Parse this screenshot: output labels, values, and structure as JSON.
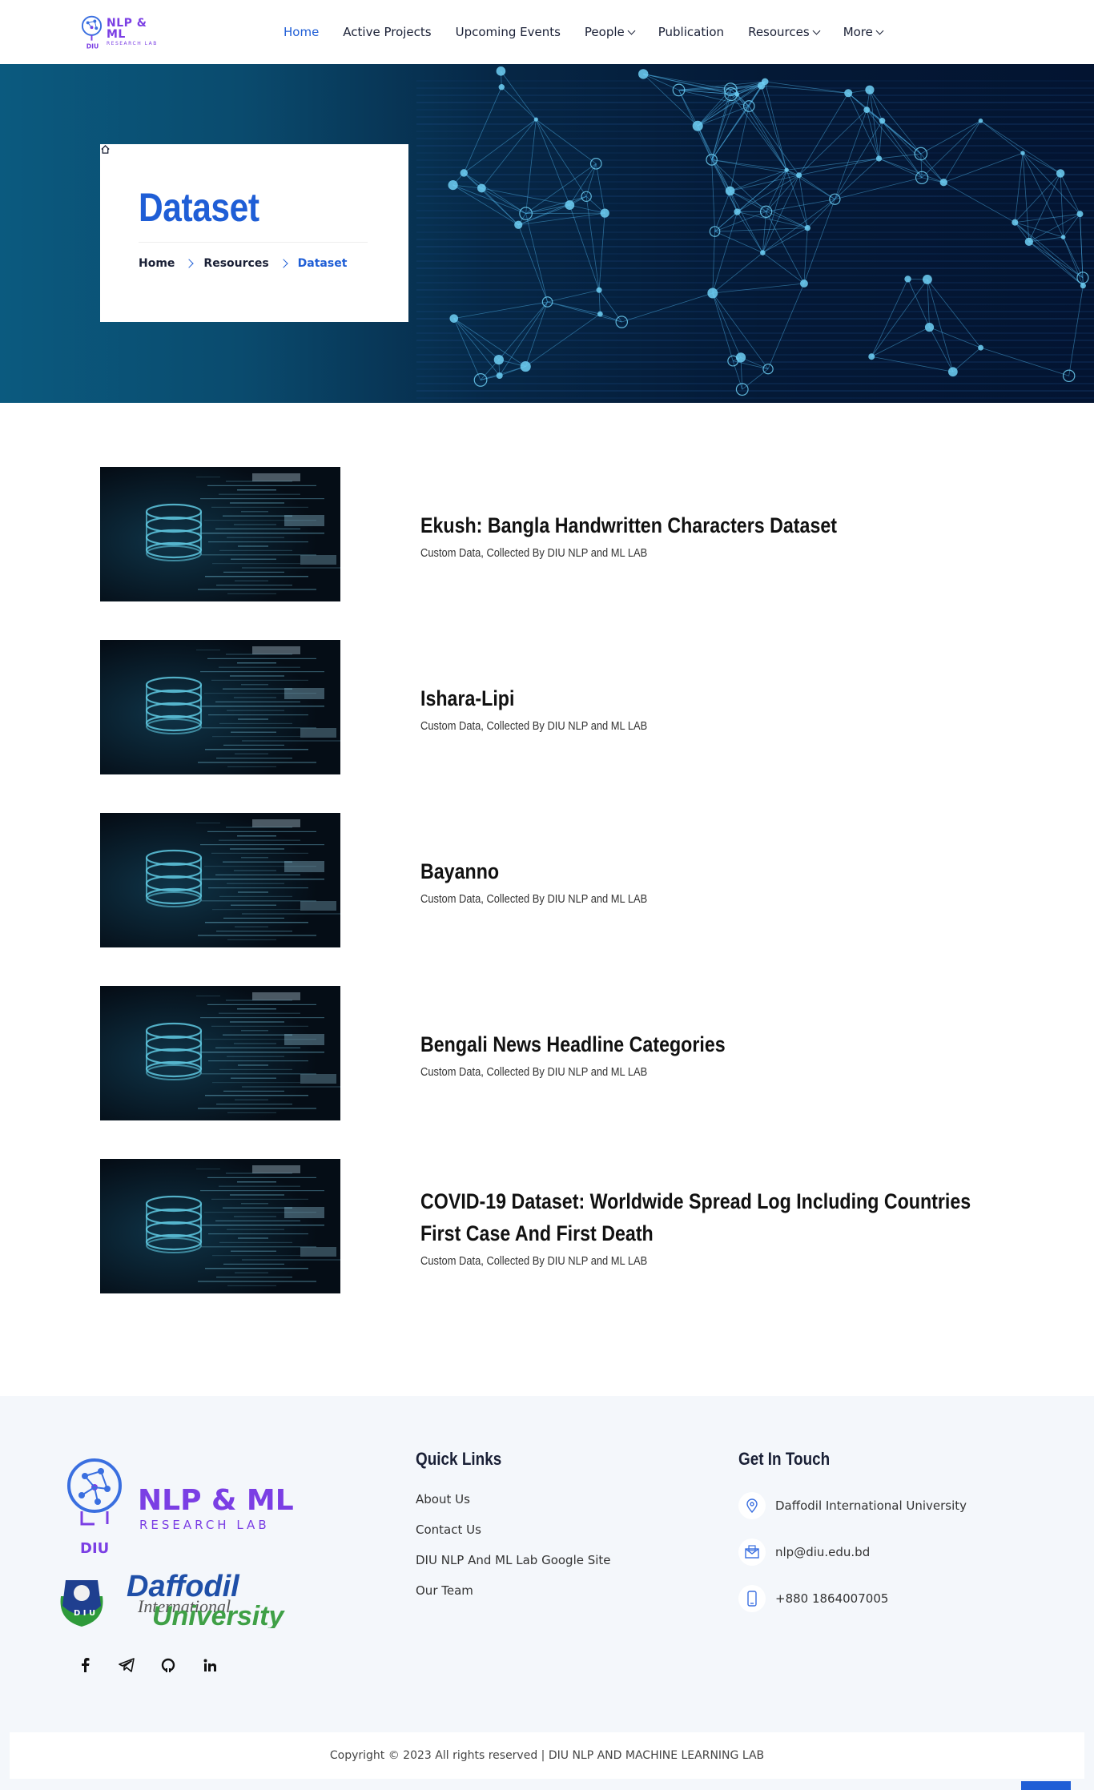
{
  "brand": {
    "title": "NLP & ML",
    "subtitle": "RESEARCH LAB",
    "mark_text": "DIU"
  },
  "nav": {
    "items": [
      {
        "label": "Home",
        "active": true,
        "dropdown": false
      },
      {
        "label": "Active Projects",
        "active": false,
        "dropdown": false
      },
      {
        "label": "Upcoming Events",
        "active": false,
        "dropdown": false
      },
      {
        "label": "People",
        "active": false,
        "dropdown": true
      },
      {
        "label": "Publication",
        "active": false,
        "dropdown": false
      },
      {
        "label": "Resources",
        "active": false,
        "dropdown": true
      },
      {
        "label": "More",
        "active": false,
        "dropdown": true
      }
    ]
  },
  "hero": {
    "title": "Dataset",
    "breadcrumb": [
      "Home",
      "Resources",
      "Dataset"
    ]
  },
  "datasets": [
    {
      "title": "Ekush: Bangla Handwritten Characters Dataset",
      "subtitle": "Custom Data, Collected By DIU NLP and ML LAB"
    },
    {
      "title": "Ishara-Lipi",
      "subtitle": "Custom Data, Collected By DIU NLP and ML LAB"
    },
    {
      "title": "Bayanno",
      "subtitle": "Custom Data, Collected By DIU NLP and ML LAB"
    },
    {
      "title": "Bengali News Headline Categories",
      "subtitle": "Custom Data, Collected By DIU NLP and ML LAB"
    },
    {
      "title": "COVID-19 Dataset: Worldwide Spread Log Including Countries First Case And First Death",
      "subtitle": "Custom Data, Collected By DIU NLP and ML LAB"
    }
  ],
  "footer": {
    "logo": {
      "title": "NLP & ML",
      "subtitle": "RESEARCH LAB",
      "mark_text": "DIU"
    },
    "university_logo": {
      "line1": "Daffodil",
      "line2": "International",
      "line3": "University"
    },
    "socials": [
      "facebook-icon",
      "telegram-icon",
      "github-icon",
      "linkedin-icon"
    ],
    "quick_links_title": "Quick Links",
    "quick_links": [
      "About Us",
      "Contact Us",
      "DIU NLP And ML Lab Google Site",
      "Our Team"
    ],
    "contact_title": "Get In Touch",
    "contacts": [
      {
        "icon": "location-icon",
        "text": "Daffodil International University"
      },
      {
        "icon": "mail-icon",
        "text": "nlp@diu.edu.bd"
      },
      {
        "icon": "phone-icon",
        "text": "+880 1864007005"
      }
    ],
    "copyright": "Copyright © 2023 All rights reserved | DIU NLP AND MACHINE LEARNING LAB"
  },
  "colors": {
    "accent": "#1f5ed6",
    "brand_purple": "#7b3fe4",
    "hero_dark": "#041936",
    "footer_bg": "#f4f7fb"
  }
}
